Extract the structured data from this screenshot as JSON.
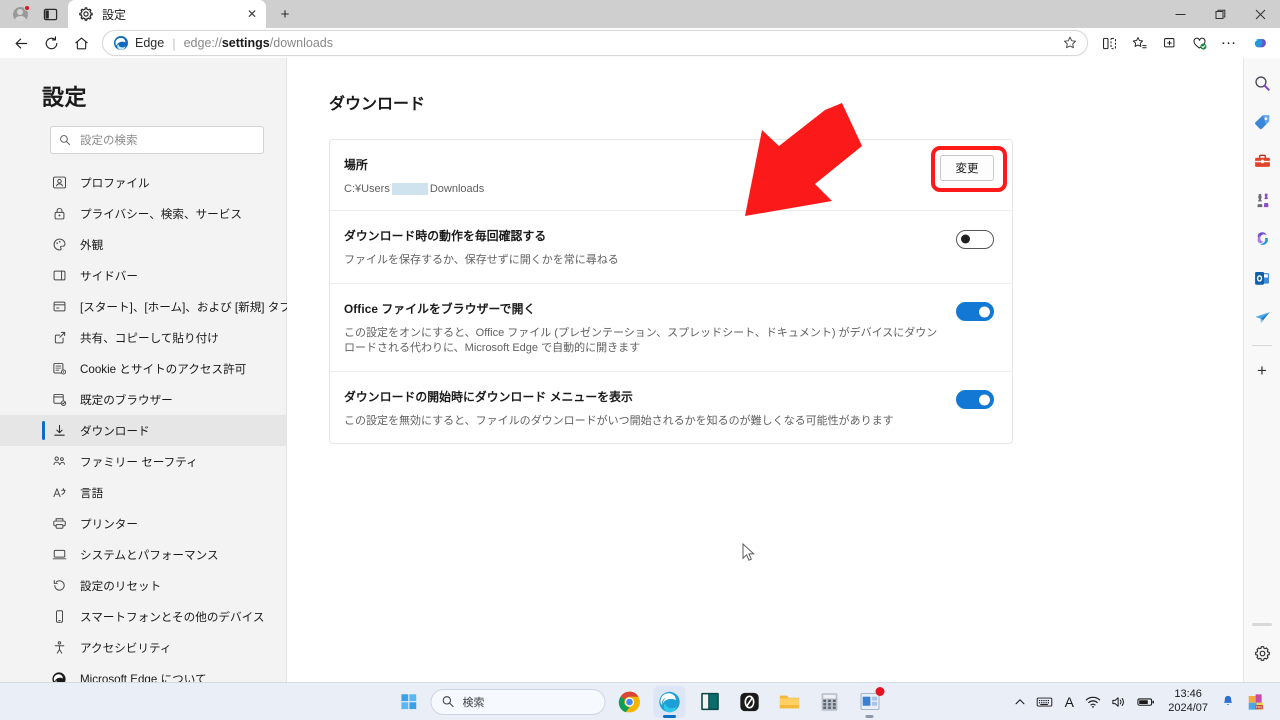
{
  "window": {
    "titlebar": {
      "avatar_name": "profile-avatar",
      "tab_actions_label": "",
      "tab": {
        "title": "設定",
        "icon": "gear-icon",
        "close_label": "✕"
      },
      "new_tab_label": "+",
      "minimize_label": "—",
      "maximize_label": "▢",
      "close_label": "✕"
    },
    "toolbar": {
      "back_label": "←",
      "refresh_label": "⟳",
      "home_label": "⌂",
      "omnibox": {
        "app_label": "Edge",
        "separator": "|",
        "url_prefix": "edge://",
        "url_bold": "settings",
        "url_suffix": "/downloads",
        "full_url": "edge://settings/downloads"
      },
      "favorite_star_label": "☆",
      "split_screen_label": "",
      "favorites_label": "",
      "collections_label": "",
      "browser_essentials_label": "",
      "more_label": "…",
      "copilot_label": ""
    }
  },
  "settings": {
    "title": "設定",
    "search": {
      "placeholder": "設定の検索",
      "value": ""
    },
    "nav_items": [
      {
        "label": "プロファイル",
        "icon": "profile-icon",
        "selected": false
      },
      {
        "label": "プライバシー、検索、サービス",
        "icon": "lock-icon",
        "selected": false
      },
      {
        "label": "外観",
        "icon": "palette-icon",
        "selected": false
      },
      {
        "label": "サイドバー",
        "icon": "sidebar-icon",
        "selected": false
      },
      {
        "label": "[スタート]、[ホーム]、および [新規] タブ",
        "icon": "newtab-icon",
        "selected": false
      },
      {
        "label": "共有、コピーして貼り付け",
        "icon": "share-icon",
        "selected": false
      },
      {
        "label": "Cookie とサイトのアクセス許可",
        "icon": "cookie-icon",
        "selected": false
      },
      {
        "label": "既定のブラウザー",
        "icon": "default-browser-icon",
        "selected": false
      },
      {
        "label": "ダウンロード",
        "icon": "download-icon",
        "selected": true
      },
      {
        "label": "ファミリー セーフティ",
        "icon": "family-icon",
        "selected": false
      },
      {
        "label": "言語",
        "icon": "language-icon",
        "selected": false
      },
      {
        "label": "プリンター",
        "icon": "printer-icon",
        "selected": false
      },
      {
        "label": "システムとパフォーマンス",
        "icon": "system-icon",
        "selected": false
      },
      {
        "label": "設定のリセット",
        "icon": "reset-icon",
        "selected": false
      },
      {
        "label": "スマートフォンとその他のデバイス",
        "icon": "phone-icon",
        "selected": false
      },
      {
        "label": "アクセシビリティ",
        "icon": "accessibility-icon",
        "selected": false
      },
      {
        "label": "Microsoft Edge について",
        "icon": "edge-icon",
        "selected": false
      }
    ]
  },
  "page": {
    "heading": "ダウンロード",
    "location_row": {
      "title": "場所",
      "path_prefix": "C:¥Users",
      "path_redacted": true,
      "path_suffix": "Downloads",
      "change_button": "変更",
      "highlighted": true
    },
    "rows": [
      {
        "title": "ダウンロード時の動作を毎回確認する",
        "subtitle": "ファイルを保存するか、保存せずに開くかを常に尋ねる",
        "toggle": "off"
      },
      {
        "title": "Office ファイルをブラウザーで開く",
        "subtitle": "この設定をオンにすると、Office ファイル (プレゼンテーション、スプレッドシート、ドキュメント) がデバイスにダウンロードされる代わりに、Microsoft Edge で自動的に開きます",
        "toggle": "on"
      },
      {
        "title": "ダウンロードの開始時にダウンロード メニューを表示",
        "subtitle": "この設定を無効にすると、ファイルのダウンロードがいつ開始されるかを知るのが難しくなる可能性があります",
        "toggle": "on"
      }
    ]
  },
  "annotation": {
    "arrow_color": "#fb1919",
    "highlight_color": "#ff1a1a",
    "arrow_direction": "down-left",
    "target": "change-button-and-location"
  },
  "rail": {
    "items": [
      {
        "name": "search-icon"
      },
      {
        "name": "shopping-tag-icon"
      },
      {
        "name": "tools-icon"
      },
      {
        "name": "games-icon"
      },
      {
        "name": "microsoft365-icon"
      },
      {
        "name": "outlook-icon"
      },
      {
        "name": "drop-paperplane-icon"
      }
    ],
    "add_label": "+",
    "settings_label": ""
  },
  "taskbar": {
    "start_label": "",
    "search_placeholder": "検索",
    "apps": [
      {
        "name": "chrome-icon",
        "active": false
      },
      {
        "name": "edge-icon",
        "active": true
      },
      {
        "name": "book-icon",
        "active": false
      },
      {
        "name": "zero-app-icon",
        "active": false
      },
      {
        "name": "file-explorer-icon",
        "active": false
      },
      {
        "name": "calculator-icon",
        "active": false
      },
      {
        "name": "teams-icon",
        "active": false,
        "badge": true
      }
    ],
    "tray": {
      "chevron_label": "⌃",
      "keyboard_label": "",
      "ime_label": "A",
      "wifi_label": "",
      "volume_label": "",
      "battery_label": "",
      "time": "13:46",
      "date": "2024/07",
      "bell_label": "",
      "app_label": "PRE"
    }
  },
  "colors": {
    "accent_blue": "#0f6cbd",
    "toggle_on": "#1278d4",
    "annotation_red": "#fb1919",
    "nav_bg": "#f3f3f3",
    "selected_bg": "#e6e6e6"
  }
}
